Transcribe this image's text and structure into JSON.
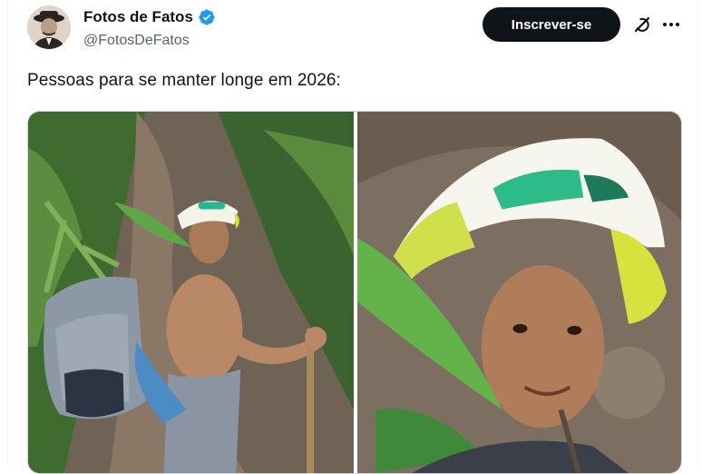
{
  "author": {
    "display_name": "Fotos de Fatos",
    "handle": "@FotosDeFatos",
    "verified": true,
    "avatar_icon": "profile-photo-man-with-hat"
  },
  "actions": {
    "subscribe_label": "Inscrever-se",
    "grok_icon": "grok-icon",
    "more_icon": "more-options-icon"
  },
  "tweet": {
    "text": "Pessoas para se manter longe em 2026:"
  },
  "media": {
    "images": [
      {
        "name": "left-photo",
        "description_icon": "photo"
      },
      {
        "name": "right-photo",
        "description_icon": "photo"
      }
    ]
  },
  "colors": {
    "verified_blue": "#1d9bf0",
    "button_bg": "#0f1419",
    "handle_gray": "#536471"
  }
}
